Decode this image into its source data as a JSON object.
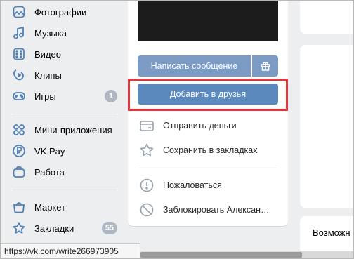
{
  "sidebar": {
    "items": [
      {
        "label": "Фотографии",
        "icon": "photos-icon"
      },
      {
        "label": "Музыка",
        "icon": "music-icon"
      },
      {
        "label": "Видео",
        "icon": "video-icon"
      },
      {
        "label": "Клипы",
        "icon": "clips-icon"
      },
      {
        "label": "Игры",
        "icon": "games-icon",
        "badge": "1"
      },
      {
        "label": "Мини-приложения",
        "icon": "mini-apps-icon"
      },
      {
        "label": "VK Pay",
        "icon": "vk-pay-icon"
      },
      {
        "label": "Работа",
        "icon": "work-icon"
      },
      {
        "label": "Маркет",
        "icon": "market-icon"
      },
      {
        "label": "Закладки",
        "icon": "bookmarks-icon",
        "badge": "55"
      }
    ]
  },
  "profile": {
    "message_button": "Написать сообщение",
    "gift_icon": "gift-icon",
    "add_friend_button": "Добавить в друзья",
    "actions": [
      {
        "label": "Отправить деньги",
        "icon": "money-transfer-icon"
      },
      {
        "label": "Сохранить в закладках",
        "icon": "star-icon"
      },
      {
        "label": "Пожаловаться",
        "icon": "report-icon"
      },
      {
        "label": "Заблокировать Алексан…",
        "icon": "block-icon"
      }
    ]
  },
  "right": {
    "bottom_label": "Возможн"
  },
  "status": {
    "url": "https://vk.com/write266973905"
  },
  "colors": {
    "accent": "#5181b8",
    "primary_button": "#5b88bd",
    "secondary_button": "#7b9bc5",
    "highlight": "#e5343c",
    "badge": "#aeb7c2"
  }
}
